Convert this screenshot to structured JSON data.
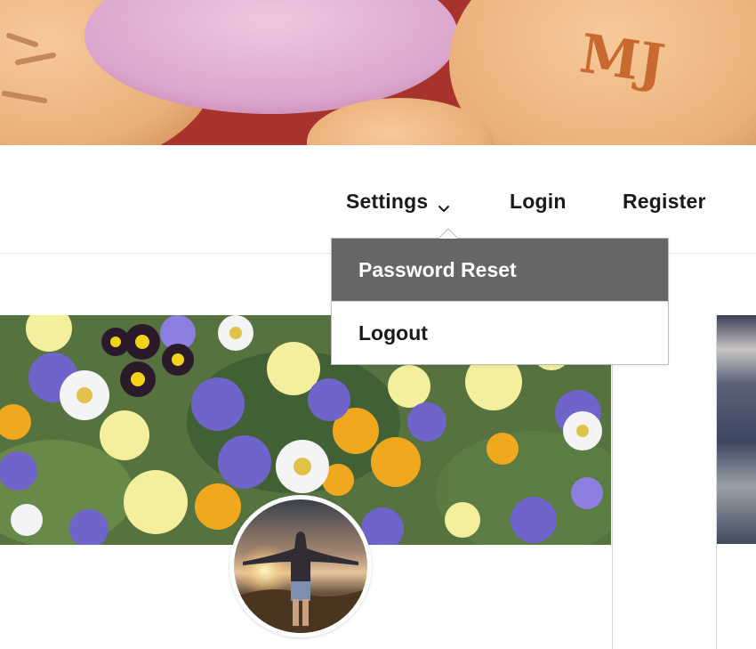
{
  "nav": {
    "settings_label": "Settings",
    "login_label": "Login",
    "register_label": "Register"
  },
  "dropdown": {
    "items": [
      {
        "label": "Password Reset",
        "state": "highlighted"
      },
      {
        "label": "Logout",
        "state": "normal"
      }
    ]
  },
  "images": {
    "banner": "candy-hearts-photo",
    "cover": "wildflowers-photo",
    "avatar": "person-at-sunset-photo",
    "side_cover": "blurred-sea-photo"
  },
  "colors": {
    "highlight_bg": "#666666",
    "highlight_text": "#ffffff",
    "nav_text": "#1a1a1a"
  }
}
